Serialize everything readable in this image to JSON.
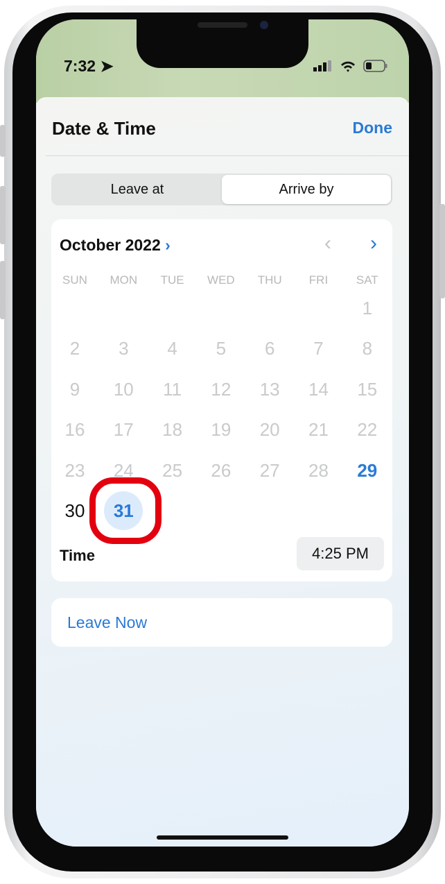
{
  "status_bar": {
    "time": "7:32",
    "icons": [
      "location-arrow-icon",
      "cellular-signal-icon",
      "wifi-icon",
      "battery-icon"
    ]
  },
  "header": {
    "title": "Date & Time",
    "done_label": "Done"
  },
  "segmented": {
    "options": [
      "Leave at",
      "Arrive by"
    ],
    "selected": "Arrive by"
  },
  "calendar": {
    "month_label": "October 2022",
    "weekdays": [
      "SUN",
      "MON",
      "TUE",
      "WED",
      "THU",
      "FRI",
      "SAT"
    ],
    "first_weekday_index": 6,
    "days": [
      1,
      2,
      3,
      4,
      5,
      6,
      7,
      8,
      9,
      10,
      11,
      12,
      13,
      14,
      15,
      16,
      17,
      18,
      19,
      20,
      21,
      22,
      23,
      24,
      25,
      26,
      27,
      28,
      29,
      30,
      31
    ],
    "today": 29,
    "selected": 31,
    "available_from": 29
  },
  "time": {
    "label": "Time",
    "value": "4:25 PM"
  },
  "leave_now_label": "Leave Now",
  "annotation": {
    "highlighted_day": 31,
    "color": "#e3000f"
  },
  "colors": {
    "accent": "#2a7ad5"
  }
}
